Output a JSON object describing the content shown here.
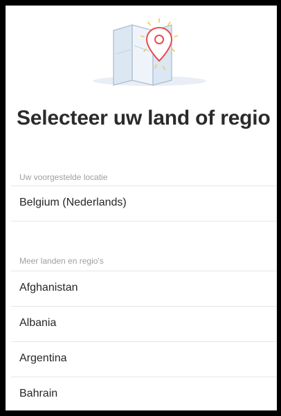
{
  "header": {
    "title": "Selecteer uw land of regio",
    "illustration_icon": "map-pin-icon",
    "accent_color": "#e84a4f"
  },
  "suggested": {
    "label": "Uw voorgestelde locatie",
    "items": [
      {
        "label": "Belgium (Nederlands)"
      }
    ]
  },
  "more": {
    "label": "Meer landen en regio's",
    "items": [
      {
        "label": "Afghanistan"
      },
      {
        "label": "Albania"
      },
      {
        "label": "Argentina"
      },
      {
        "label": "Bahrain"
      }
    ]
  }
}
